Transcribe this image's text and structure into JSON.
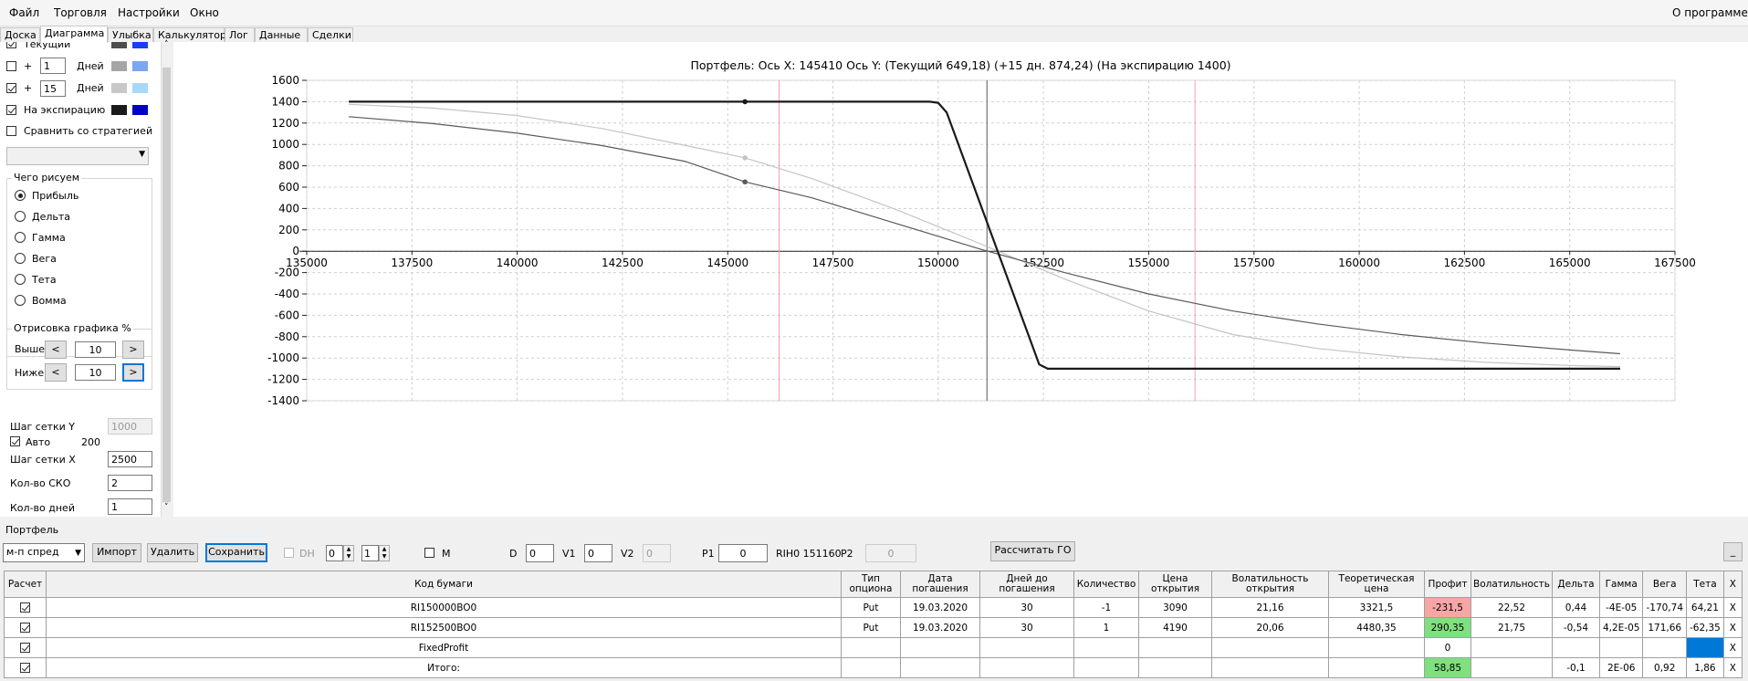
{
  "menu": {
    "file": "Файл",
    "trade": "Торговля",
    "settings": "Настройки",
    "window": "Окно",
    "about": "О программе"
  },
  "tabs": [
    "Доска",
    "Диаграмма",
    "Улыбка",
    "Калькулятор",
    "Лог",
    "Данные",
    "Сделки"
  ],
  "left": {
    "current_label": "Текущий",
    "plus1": "+",
    "plus1_value": "1",
    "days1": "Дней",
    "plus2": "+",
    "plus2_value": "15",
    "days2": "Дней",
    "expiry_label": "На экспирацию",
    "compare_label": "Сравнить со стратегией",
    "what_title": "Чего рисуем",
    "radios": [
      "Прибыль",
      "Дельта",
      "Гамма",
      "Вега",
      "Тета",
      "Вомма"
    ],
    "draw_title": "Отрисовка графика %",
    "above_label": "Выше",
    "above_value": "10",
    "below_label": "Ниже",
    "below_value": "10",
    "lt": "<",
    "gt": ">",
    "grid_y_label": "Шаг сетки Y",
    "grid_y_value": "1000",
    "auto_label": "Авто",
    "auto_value": "200",
    "grid_x_label": "Шаг сетки X",
    "grid_x_value": "2500",
    "sko_label": "Кол-во СКО",
    "sko_value": "2",
    "days_label": "Кол-во дней",
    "days_value": "1"
  },
  "colors": {
    "current_dark": "#4d4d4d",
    "current_light": "#1a3cff",
    "plus1_dark": "#a6a6a6",
    "plus1_light": "#7aa7f0",
    "plus2_dark": "#c8c8c8",
    "plus2_light": "#a8d8f8",
    "expiry_dark": "#1a1a1a",
    "expiry_light": "#0000c8",
    "neg": "#f7a6a6",
    "pos": "#7ee07e",
    "selected": "#0078d7"
  },
  "chart_title": "Портфель: Ось X: 145410 Ось Y:  (Текущий 649,18)  (+15 дн. 874,24)  (На экспирацию 1400)",
  "chart_data": {
    "type": "line",
    "xlim": [
      135000,
      167500
    ],
    "ylim": [
      -1400,
      1600
    ],
    "x_ticks": [
      135000,
      137500,
      140000,
      142500,
      145000,
      147500,
      150000,
      152500,
      155000,
      157500,
      160000,
      162500,
      165000,
      167500
    ],
    "y_ticks": [
      1600,
      1400,
      1200,
      1000,
      800,
      600,
      400,
      200,
      0,
      -200,
      -400,
      -600,
      -800,
      -1000,
      -1200,
      -1400
    ],
    "grid": true,
    "vertical_markers": {
      "current_price": 151160,
      "sko_lower": 146220,
      "sko_upper": 156100
    },
    "cursor": {
      "x": 145410,
      "points": [
        1400,
        649.18,
        874.24
      ]
    },
    "series": [
      {
        "color": "#1a1a1a",
        "width": 2.2,
        "points": [
          [
            136000,
            1400
          ],
          [
            149800,
            1400
          ],
          [
            150000,
            1390
          ],
          [
            150200,
            1300
          ],
          [
            152400,
            -1060
          ],
          [
            152600,
            -1100
          ],
          [
            166200,
            -1100
          ]
        ]
      },
      {
        "color": "#5a5a5a",
        "width": 1.2,
        "points": [
          [
            136000,
            1260
          ],
          [
            138000,
            1195
          ],
          [
            140000,
            1105
          ],
          [
            142000,
            990
          ],
          [
            144000,
            840
          ],
          [
            145410,
            649.18
          ],
          [
            147000,
            500
          ],
          [
            149000,
            260
          ],
          [
            151000,
            20
          ],
          [
            153000,
            -200
          ],
          [
            155000,
            -400
          ],
          [
            157000,
            -560
          ],
          [
            159000,
            -680
          ],
          [
            161000,
            -780
          ],
          [
            163000,
            -860
          ],
          [
            165000,
            -925
          ],
          [
            166200,
            -960
          ]
        ]
      },
      {
        "color": "#c4c4c4",
        "width": 1.2,
        "points": [
          [
            136000,
            1375
          ],
          [
            138000,
            1340
          ],
          [
            140000,
            1270
          ],
          [
            142000,
            1150
          ],
          [
            144000,
            990
          ],
          [
            145410,
            874.24
          ],
          [
            147000,
            680
          ],
          [
            149000,
            390
          ],
          [
            151000,
            70
          ],
          [
            153000,
            -260
          ],
          [
            155000,
            -560
          ],
          [
            157000,
            -780
          ],
          [
            159000,
            -910
          ],
          [
            161000,
            -990
          ],
          [
            163000,
            -1040
          ],
          [
            165000,
            -1070
          ],
          [
            166200,
            -1080
          ]
        ]
      }
    ]
  },
  "portfolio": {
    "title": "Портфель",
    "strategy": "м-п спред",
    "import_btn": "Импорт",
    "delete_btn": "Удалить",
    "save_btn": "Сохранить",
    "dh_label": "DH",
    "dh_v1": "0",
    "dh_v2": "1",
    "m_label": "M",
    "d_label": "D",
    "d_value": "0",
    "v1_label": "V1",
    "v1_value": "0",
    "v2_label": "V2",
    "v2_value": "0",
    "p1_label": "P1",
    "p1_value": "0",
    "rih_label": "RIH0 151160",
    "p2_label": "P2",
    "p2_value": "0",
    "calc_go": "Рассчитать ГО",
    "minimize": "_",
    "headers": [
      "Расчет",
      "Код бумаги",
      "Тип опциона",
      "Дата погашения",
      "Дней до погашения",
      "Количество",
      "Цена открытия",
      "Волатильность открытия",
      "Теоретическая цена",
      "Профит",
      "Волатильность",
      "Дельта",
      "Гамма",
      "Вега",
      "Тета",
      "X"
    ],
    "rows": [
      [
        "",
        "RI150000BO0",
        "Put",
        "19.03.2020",
        "30",
        "-1",
        "3090",
        "21,16",
        "3321,5",
        "-231,5",
        "22,52",
        "0,44",
        "-4E-05",
        "-170,74",
        "64,21",
        "X"
      ],
      [
        "",
        "RI152500BO0",
        "Put",
        "19.03.2020",
        "30",
        "1",
        "4190",
        "20,06",
        "4480,35",
        "290,35",
        "21,75",
        "-0,54",
        "4,2E-05",
        "171,66",
        "-62,35",
        "X"
      ],
      [
        "",
        "FixedProfit",
        "",
        "",
        "",
        "",
        "",
        "",
        "",
        "0",
        "",
        "",
        "",
        "",
        "",
        "X"
      ],
      [
        "",
        "Итого:",
        "",
        "",
        "",
        "",
        "",
        "",
        "",
        "58,85",
        "",
        "-0,1",
        "2E-06",
        "0,92",
        "1,86",
        "X"
      ]
    ]
  }
}
